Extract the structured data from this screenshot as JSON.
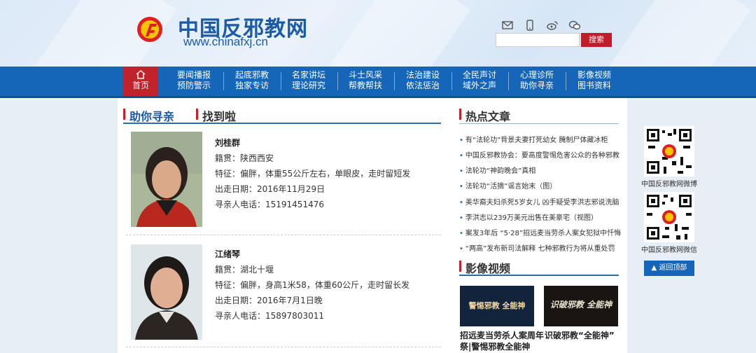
{
  "header": {
    "title": "中国反邪教网",
    "url": "www.chinafxj.cn",
    "search_placeholder": "",
    "search_button": "搜索",
    "icons": [
      "mail-icon",
      "phone-icon",
      "weibo-icon",
      "wechat-icon"
    ]
  },
  "nav": {
    "home": "首页",
    "items": [
      {
        "l1": "要闻播报",
        "l2": "预防警示"
      },
      {
        "l1": "起底邪教",
        "l2": "独家专访"
      },
      {
        "l1": "名家讲坛",
        "l2": "理论研究"
      },
      {
        "l1": "斗士风采",
        "l2": "帮教帮扶"
      },
      {
        "l1": "法治建设",
        "l2": "依法惩治"
      },
      {
        "l1": "全民声讨",
        "l2": "域外之声"
      },
      {
        "l1": "心理诊所",
        "l2": "助你寻亲"
      },
      {
        "l1": "影像视频",
        "l2": "图书资料"
      }
    ]
  },
  "main": {
    "section_title": "助你寻亲",
    "subsection_title": "找到啦",
    "persons": [
      {
        "name": "刘桂群",
        "hometown": "籍贯：陕西西安",
        "features": "特征：偏胖，体重55公斤左右，单眼皮，走时留短发",
        "left_date": "出走日期：2016年11月29日",
        "phone": "寻亲人电话：15191451476"
      },
      {
        "name": "江绪琴",
        "hometown": "籍贯：湖北十堰",
        "features": "特征：偏胖，身高1米58，体重60公斤，走时留长发",
        "left_date": "出走日期：2016年7月1日晚",
        "phone": "寻亲人电话：15897803011"
      }
    ]
  },
  "hot": {
    "title": "热点文章",
    "items": [
      "有“法轮功”背景夫妻打死幼女 腌制尸体藏冰柜",
      "中国反邪教协会：要高度警惕危害公众的各种邪教",
      "法轮功“神韵晚会”真相",
      "法轮功“活摘”谣言始末（图）",
      "美华裔夫妇杀死5岁女儿 凶手疑受李洪志邪说洗脑",
      "李洪志以239万美元出售在美豪宅（视图）",
      "案发3年后 “5·28”招远麦当劳杀人案女犯狱中忏悔",
      "“两高”发布新司法解释 七种邪教行为将从重处罚"
    ]
  },
  "video": {
    "title": "影像视频",
    "items": [
      {
        "caption1": "招远麦当劳杀人案周年",
        "caption2": "祭|警惕邪教全能神",
        "thumb_text": "警惕邪教 全能神"
      },
      {
        "caption1": "识破邪教“全能神”",
        "caption2": "",
        "thumb_text": "识破邪教 全能神"
      }
    ]
  },
  "sidebar": {
    "qr1_caption": "中国反邪教网微博",
    "qr2_caption": "中国反邪教网微信",
    "back_top": "返回顶部"
  },
  "colors": {
    "brand_blue": "#1565b8",
    "accent_red": "#c0232b"
  }
}
